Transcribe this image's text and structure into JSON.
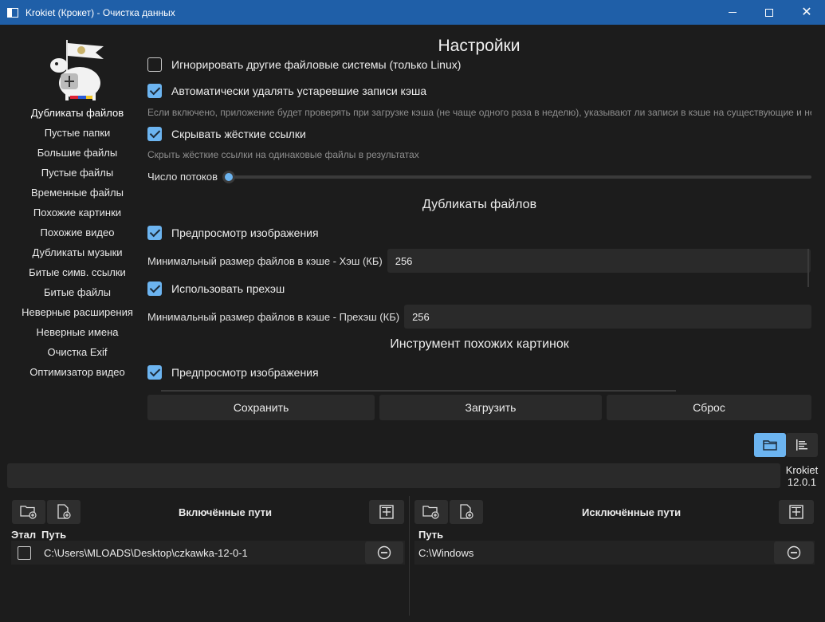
{
  "window": {
    "title": "Krokiet (Крокет) - Очистка данных",
    "icons": {
      "minimize": "minimize-icon",
      "maximize": "maximize-icon",
      "close": "close-icon"
    },
    "close_glyph": "✕"
  },
  "nav": {
    "items": [
      "Дубликаты файлов",
      "Пустые папки",
      "Большие файлы",
      "Пустые файлы",
      "Временные файлы",
      "Похожие картинки",
      "Похожие видео",
      "Дубликаты музыки",
      "Битые симв. ссылки",
      "Битые файлы",
      "Неверные расширения",
      "Неверные имена",
      "Очистка Exif",
      "Оптимизатор видео"
    ]
  },
  "settings": {
    "title": "Настройки",
    "ignore_other_fs": {
      "label": "Игнорировать другие файловые системы (только Linux)",
      "checked": false
    },
    "auto_delete_cache": {
      "label": "Автоматически удалять устаревшие записи кэша",
      "checked": true
    },
    "auto_delete_hint": "Если включено, приложение будет проверять при загрузке кэша (не чаще одного раза в неделю), указывают ли записи в кэше на существующие и не",
    "hide_hardlinks": {
      "label": "Скрывать жёсткие ссылки",
      "checked": true
    },
    "hide_hardlinks_hint": "Скрыть жёсткие ссылки на одинаковые файлы в результатах",
    "threads_label": "Число потоков",
    "threads_level": 0,
    "dup_section": "Дубликаты файлов",
    "dup_image_preview": {
      "label": "Предпросмотр изображения",
      "checked": true
    },
    "min_cache_hash_label": "Минимальный размер файлов в кэше - Хэш (КБ)",
    "min_cache_hash_value": "256",
    "use_prehash": {
      "label": "Использовать прехэш",
      "checked": true
    },
    "min_cache_prehash_label": "Минимальный размер файлов в кэше - Прехэш (КБ)",
    "min_cache_prehash_value": "256",
    "similar_images_section": "Инструмент похожих картинок",
    "sim_image_preview": {
      "label": "Предпросмотр изображения",
      "checked": true
    }
  },
  "actions": {
    "save": "Сохранить",
    "load": "Загрузить",
    "reset": "Сброс"
  },
  "view_toggles": {
    "folder": "folder-icon",
    "list": "list-icon",
    "active": "folder"
  },
  "version": {
    "line1": "Krokiet",
    "line2": "12.0.1"
  },
  "included": {
    "title": "Включённые пути",
    "col_ref": "Этал",
    "col_path": "Путь",
    "rows": [
      {
        "path": "C:\\Users\\MLOADS\\Desktop\\czkawka-12-0-1",
        "reference": false
      }
    ]
  },
  "excluded": {
    "title": "Исключённые пути",
    "col_path": "Путь",
    "rows": [
      {
        "path": "C:\\Windows"
      }
    ]
  },
  "colors": {
    "accent": "#6cb4f0",
    "titlebar": "#1f5fa8",
    "background": "#1c1c1c"
  }
}
